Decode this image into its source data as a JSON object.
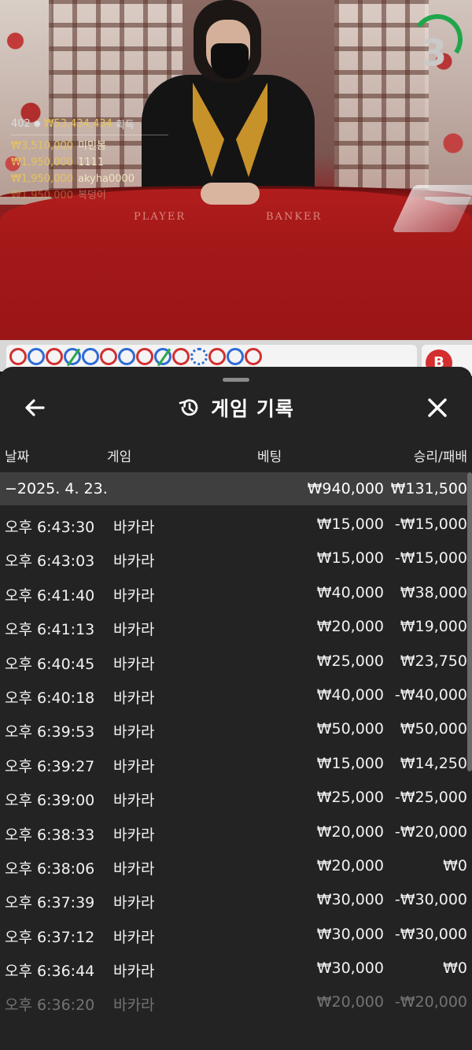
{
  "video": {
    "felt_labels": {
      "player": "PLAYER",
      "banker": "BANKER"
    },
    "countdown": "3",
    "overlay": {
      "count": "402",
      "person_icon": "person-icon",
      "total": "₩53,434,434",
      "total_suffix": "획득",
      "winners": [
        {
          "amount": "₩3,510,000",
          "name": "미민봄"
        },
        {
          "amount": "₩1,950,000",
          "name": "1111"
        },
        {
          "amount": "₩1,950,000",
          "name": "akyha0000"
        },
        {
          "amount": "₩1,950,000",
          "name": "복덩이"
        }
      ]
    }
  },
  "road": {
    "beads": [
      "red",
      "blue",
      "red",
      "blue-slash",
      "blue",
      "red",
      "blue",
      "red",
      "blue-slash",
      "red",
      "blue-dot",
      "red",
      "blue",
      "red"
    ],
    "side_badge": "B",
    "colors": {
      "red": "#d32f2f",
      "blue": "#2e6bd8",
      "green": "#2aa84a"
    }
  },
  "sheet": {
    "back_icon": "arrow-left-icon",
    "history_icon": "history-icon",
    "title": "게임 기록",
    "close_icon": "close-icon",
    "columns": {
      "date": "날짜",
      "game": "게임",
      "bet": "베팅",
      "result": "승리/패배"
    },
    "date_group": {
      "label": "−2025. 4. 23.",
      "bet_total": "₩940,000",
      "result_total": "₩131,500"
    },
    "rows": [
      {
        "time": "오후 6:43:30",
        "game": "바카라",
        "bet": "₩15,000",
        "result": "-₩15,000"
      },
      {
        "time": "오후 6:43:03",
        "game": "바카라",
        "bet": "₩15,000",
        "result": "-₩15,000"
      },
      {
        "time": "오후 6:41:40",
        "game": "바카라",
        "bet": "₩40,000",
        "result": "₩38,000"
      },
      {
        "time": "오후 6:41:13",
        "game": "바카라",
        "bet": "₩20,000",
        "result": "₩19,000"
      },
      {
        "time": "오후 6:40:45",
        "game": "바카라",
        "bet": "₩25,000",
        "result": "₩23,750"
      },
      {
        "time": "오후 6:40:18",
        "game": "바카라",
        "bet": "₩40,000",
        "result": "-₩40,000"
      },
      {
        "time": "오후 6:39:53",
        "game": "바카라",
        "bet": "₩50,000",
        "result": "₩50,000"
      },
      {
        "time": "오후 6:39:27",
        "game": "바카라",
        "bet": "₩15,000",
        "result": "₩14,250"
      },
      {
        "time": "오후 6:39:00",
        "game": "바카라",
        "bet": "₩25,000",
        "result": "-₩25,000"
      },
      {
        "time": "오후 6:38:33",
        "game": "바카라",
        "bet": "₩20,000",
        "result": "-₩20,000"
      },
      {
        "time": "오후 6:38:06",
        "game": "바카라",
        "bet": "₩20,000",
        "result": "₩0"
      },
      {
        "time": "오후 6:37:39",
        "game": "바카라",
        "bet": "₩30,000",
        "result": "-₩30,000"
      },
      {
        "time": "오후 6:37:12",
        "game": "바카라",
        "bet": "₩30,000",
        "result": "-₩30,000"
      },
      {
        "time": "오후 6:36:44",
        "game": "바카라",
        "bet": "₩30,000",
        "result": "₩0"
      },
      {
        "time": "오후 6:36:20",
        "game": "바카라",
        "bet": "₩20,000",
        "result": "-₩20,000"
      }
    ]
  }
}
